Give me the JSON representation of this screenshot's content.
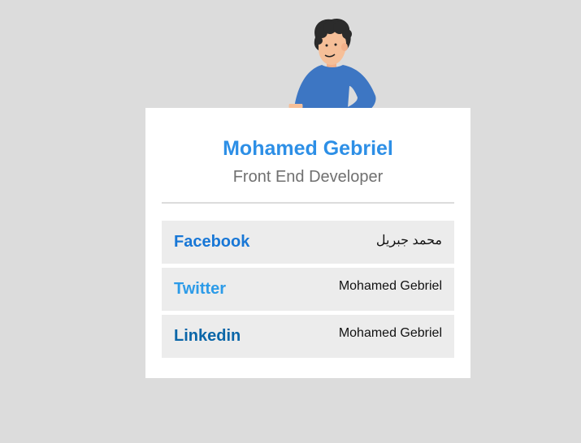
{
  "profile": {
    "name": "Mohamed Gebriel",
    "role": "Front End Developer"
  },
  "colors": {
    "background": "#dcdcdc",
    "name": "#2d8fe6",
    "facebook": "#1877d6",
    "twitter": "#2c9be8",
    "linkedin": "#0a66a8",
    "row": "#ececec"
  },
  "illustration_icon": "person-pointing-illustration",
  "links": [
    {
      "site": "Facebook",
      "handle": "محمد جبريل",
      "color": "#1877d6"
    },
    {
      "site": "Twitter",
      "handle": "Mohamed Gebriel",
      "color": "#2c9be8"
    },
    {
      "site": "Linkedin",
      "handle": "Mohamed Gebriel",
      "color": "#0a66a8"
    }
  ]
}
